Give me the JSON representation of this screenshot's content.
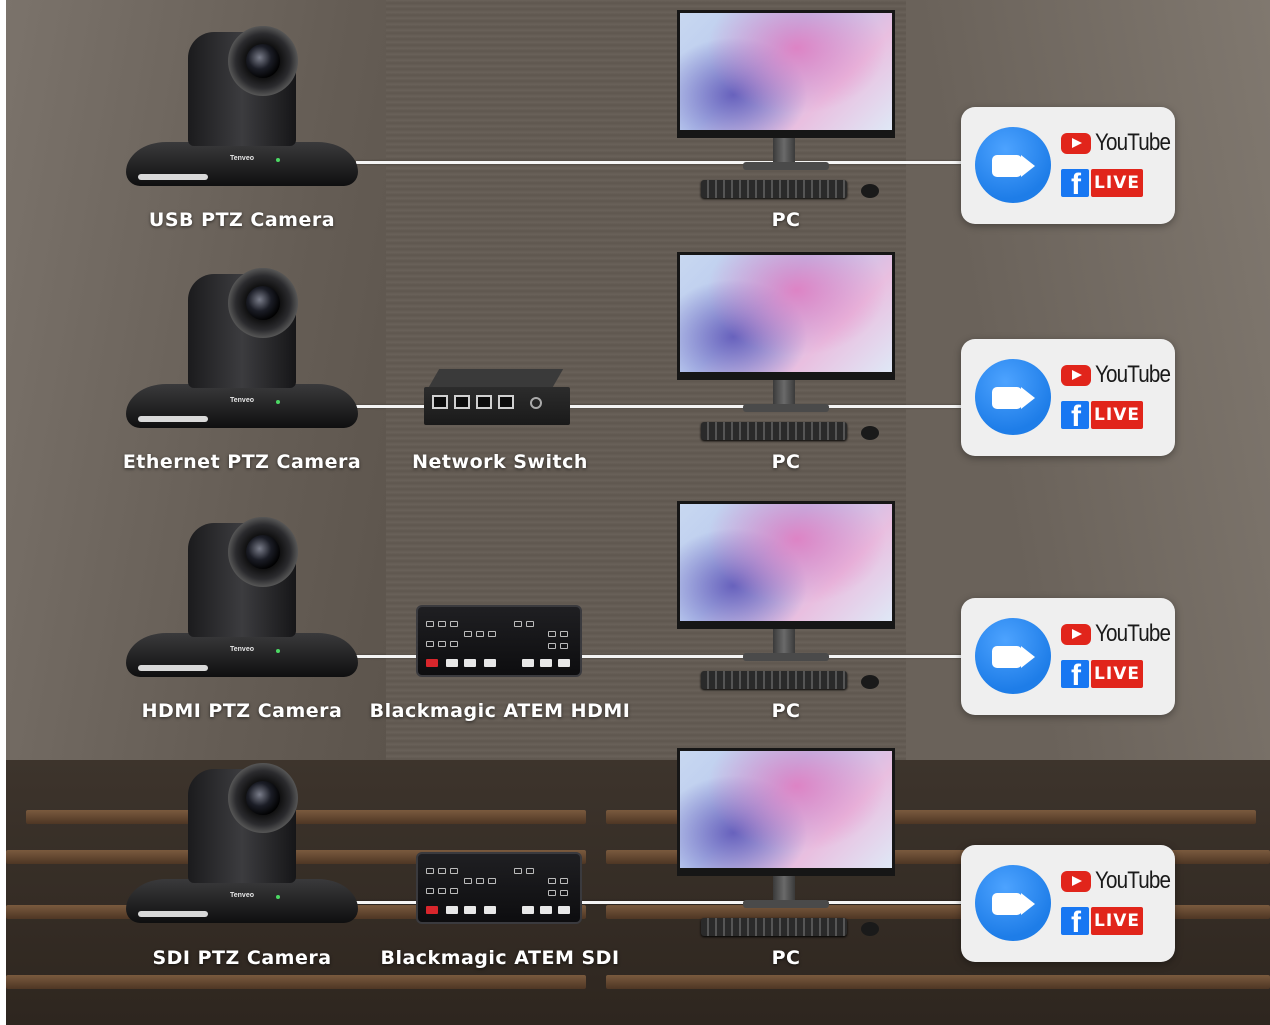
{
  "rows": [
    {
      "camera_label": "USB PTZ Camera",
      "intermediate_label": "",
      "pc_label": "PC",
      "camera_brand": "Tenveo"
    },
    {
      "camera_label": "Ethernet PTZ Camera",
      "intermediate_label": "Network Switch",
      "pc_label": "PC",
      "camera_brand": "Tenveo"
    },
    {
      "camera_label": "HDMI PTZ Camera",
      "intermediate_label": "Blackmagic ATEM HDMI",
      "pc_label": "PC",
      "camera_brand": "Tenveo"
    },
    {
      "camera_label": "SDI PTZ Camera",
      "intermediate_label": "Blackmagic ATEM SDI",
      "pc_label": "PC",
      "camera_brand": "Tenveo"
    }
  ],
  "stream_card": {
    "youtube_text": "YouTube",
    "facebook_glyph": "f",
    "live_text": "LIVE",
    "icons": [
      "zoom-video-icon",
      "youtube-play-icon",
      "facebook-icon"
    ]
  },
  "colors": {
    "zoom_blue": "#1e7de8",
    "youtube_red": "#e1251b",
    "facebook_blue": "#1877f2",
    "wire": "#f4f4f4"
  }
}
